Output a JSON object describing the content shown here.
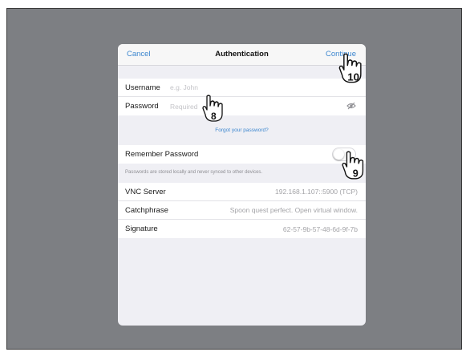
{
  "nav": {
    "cancel": "Cancel",
    "title": "Authentication",
    "continue": "Continue"
  },
  "credentials": {
    "username_label": "Username",
    "username_placeholder": "e.g. John",
    "password_label": "Password",
    "password_placeholder": "Required"
  },
  "forgot_link": "Forgot your password?",
  "remember": {
    "label": "Remember Password",
    "enabled": false,
    "footnote": "Passwords are stored locally and never synced to other devices."
  },
  "info": [
    {
      "label": "VNC Server",
      "value": "192.168.1.107::5900 (TCP)"
    },
    {
      "label": "Catchphrase",
      "value": "Spoon quest perfect. Open virtual window."
    },
    {
      "label": "Signature",
      "value": "62-57-9b-57-48-6d-9f-7b"
    }
  ],
  "callouts": [
    "8",
    "9",
    "10"
  ],
  "icons": {
    "eye": "eye-slash-icon",
    "hand": "pointing-hand-icon"
  },
  "colors": {
    "accent": "#3d87cf",
    "backdrop": "#7d7f83",
    "sheet_bg": "#efeff4"
  }
}
